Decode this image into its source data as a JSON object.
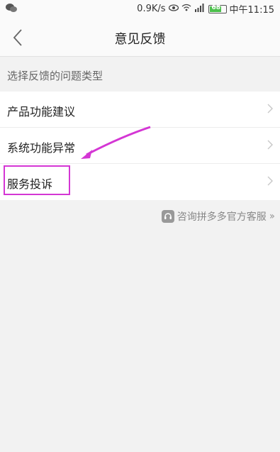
{
  "status_bar": {
    "speed": "0.9K/s",
    "battery": "68",
    "time": "中午11:15"
  },
  "nav": {
    "title": "意见反馈"
  },
  "section": {
    "header": "选择反馈的问题类型"
  },
  "items": [
    {
      "label": "产品功能建议"
    },
    {
      "label": "系统功能异常"
    },
    {
      "label": "服务投诉"
    }
  ],
  "service_link": {
    "label": "咨询拼多多官方客服"
  },
  "colors": {
    "highlight": "#d436d4",
    "battery": "#4cbf4c"
  }
}
